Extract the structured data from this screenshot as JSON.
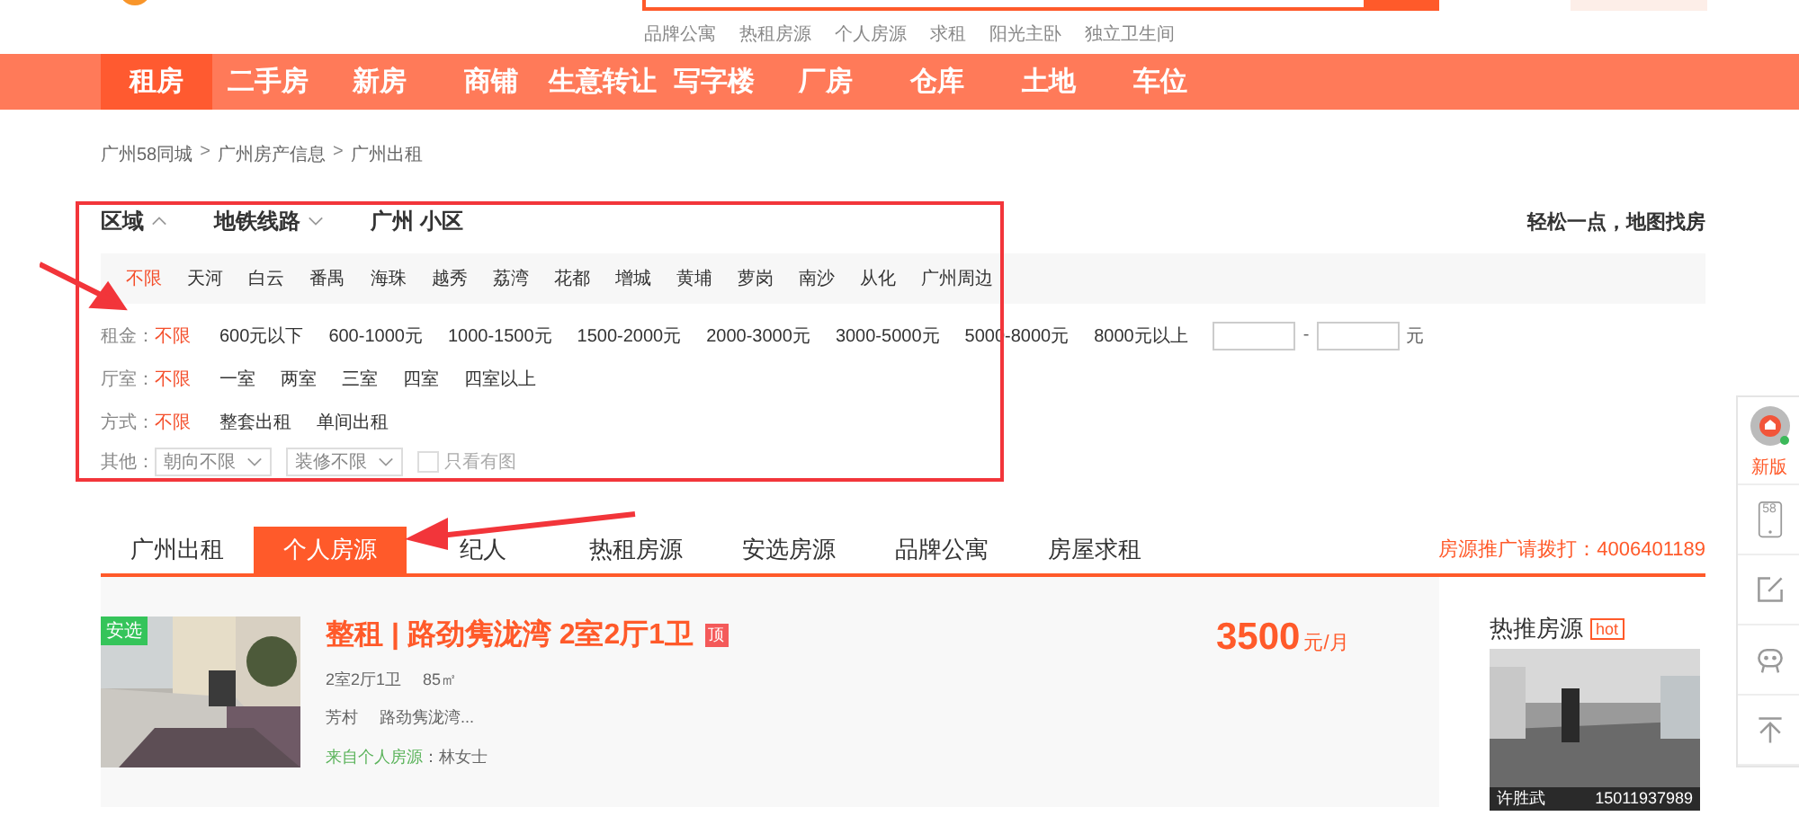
{
  "header": {
    "links": [
      "品牌公寓",
      "热租房源",
      "个人房源",
      "求租",
      "阳光主卧",
      "独立卫生间"
    ]
  },
  "nav": [
    {
      "label": "租房",
      "selected": true
    },
    {
      "label": "二手房",
      "selected": false
    },
    {
      "label": "新房",
      "selected": false
    },
    {
      "label": "商铺",
      "selected": false
    },
    {
      "label": "生意转让",
      "selected": false
    },
    {
      "label": "写字楼",
      "selected": false
    },
    {
      "label": "厂房",
      "selected": false
    },
    {
      "label": "仓库",
      "selected": false
    },
    {
      "label": "土地",
      "selected": false
    },
    {
      "label": "车位",
      "selected": false
    }
  ],
  "breadcrumb": {
    "items": [
      "广州58同城",
      "广州房产信息",
      "广州出租"
    ],
    "separator": ">"
  },
  "filter_tabs": [
    {
      "label": "区域",
      "kind": "dropdown",
      "expanded": true
    },
    {
      "label": "地铁线路",
      "kind": "dropdown",
      "expanded": false
    },
    {
      "label": "广州 小区",
      "kind": "plain"
    }
  ],
  "map_link": "轻松一点，地图找房",
  "areas": [
    {
      "label": "不限",
      "selected": true
    },
    {
      "label": "天河",
      "selected": false
    },
    {
      "label": "白云",
      "selected": false
    },
    {
      "label": "番禺",
      "selected": false
    },
    {
      "label": "海珠",
      "selected": false
    },
    {
      "label": "越秀",
      "selected": false
    },
    {
      "label": "荔湾",
      "selected": false
    },
    {
      "label": "花都",
      "selected": false
    },
    {
      "label": "增城",
      "selected": false
    },
    {
      "label": "黄埔",
      "selected": false
    },
    {
      "label": "萝岗",
      "selected": false
    },
    {
      "label": "南沙",
      "selected": false
    },
    {
      "label": "从化",
      "selected": false
    },
    {
      "label": "广州周边",
      "selected": false
    }
  ],
  "filter_rows": [
    {
      "label": "租金：",
      "options": [
        {
          "label": "不限",
          "selected": true
        },
        {
          "label": "600元以下",
          "selected": false
        },
        {
          "label": "600-1000元",
          "selected": false
        },
        {
          "label": "1000-1500元",
          "selected": false
        },
        {
          "label": "1500-2000元",
          "selected": false
        },
        {
          "label": "2000-3000元",
          "selected": false
        },
        {
          "label": "3000-5000元",
          "selected": false
        },
        {
          "label": "5000-8000元",
          "selected": false
        },
        {
          "label": "8000元以上",
          "selected": false
        }
      ],
      "range": {
        "separator": "-",
        "unit": "元"
      }
    },
    {
      "label": "厅室：",
      "options": [
        {
          "label": "不限",
          "selected": true
        },
        {
          "label": "一室",
          "selected": false
        },
        {
          "label": "两室",
          "selected": false
        },
        {
          "label": "三室",
          "selected": false
        },
        {
          "label": "四室",
          "selected": false
        },
        {
          "label": "四室以上",
          "selected": false
        }
      ]
    },
    {
      "label": "方式：",
      "options": [
        {
          "label": "不限",
          "selected": true
        },
        {
          "label": "整套出租",
          "selected": false
        },
        {
          "label": "单间出租",
          "selected": false
        }
      ]
    }
  ],
  "other": {
    "label": "其他：",
    "selects": [
      "朝向不限",
      "装修不限"
    ],
    "checkbox": {
      "label": "只看有图",
      "checked": false
    }
  },
  "tabs": [
    {
      "label": "广州出租",
      "selected": false
    },
    {
      "label": "个人房源",
      "selected": true
    },
    {
      "label": "纪人",
      "selected": false
    },
    {
      "label": "热租房源",
      "selected": false
    },
    {
      "label": "安选房源",
      "selected": false
    },
    {
      "label": "品牌公寓",
      "selected": false
    },
    {
      "label": "房屋求租",
      "selected": false
    }
  ],
  "promo": "房源推广请拨打：4006401189",
  "listing": {
    "badge": "安选",
    "title": "整租 | 路劲隽泷湾 2室2厅1卫",
    "top_badge": "顶",
    "meta": [
      "2室2厅1卫",
      "85㎡"
    ],
    "location": [
      "芳村",
      "路劲隽泷湾..."
    ],
    "source": "来自个人房源",
    "contact": "：林女士",
    "price": "3500",
    "price_unit": "元/月"
  },
  "hot": {
    "title": "热推房源",
    "badge": "hot",
    "name": "许胜武",
    "phone": "15011937989"
  },
  "side": {
    "new_label": "新版",
    "phone_label": "58"
  }
}
